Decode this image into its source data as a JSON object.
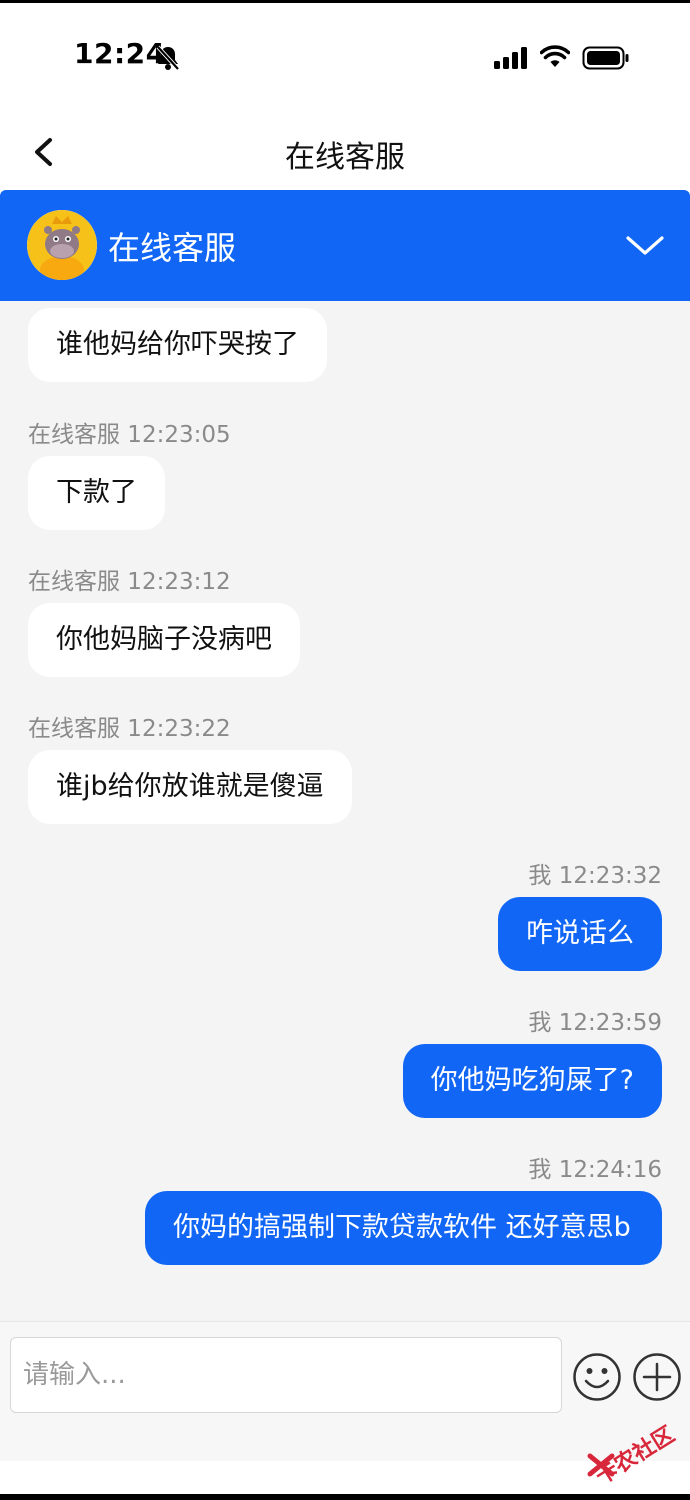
{
  "status_bar": {
    "time": "12:24"
  },
  "nav": {
    "title": "在线客服"
  },
  "agent_header": {
    "name": "在线客服"
  },
  "messages": [
    {
      "side": "in",
      "timestamp": "",
      "text": "谁他妈给你吓哭按了"
    },
    {
      "side": "in",
      "timestamp": "在线客服 12:23:05",
      "text": "下款了"
    },
    {
      "side": "in",
      "timestamp": "在线客服 12:23:12",
      "text": "你他妈脑子没病吧"
    },
    {
      "side": "in",
      "timestamp": "在线客服 12:23:22",
      "text": "谁jb给你放谁就是傻逼"
    },
    {
      "side": "out",
      "timestamp": "我 12:23:32",
      "text": "咋说话么"
    },
    {
      "side": "out",
      "timestamp": "我 12:23:59",
      "text": "你他妈吃狗屎了?"
    },
    {
      "side": "out",
      "timestamp": "我 12:24:16",
      "text": "你妈的搞强制下款贷款软件 还好意思b"
    }
  ],
  "input": {
    "placeholder": "请输入..."
  },
  "watermark": {
    "text": "卡农社区"
  },
  "colors": {
    "accent": "#1166f5",
    "chat_background": "#f4f4f4",
    "incoming_bubble": "#ffffff",
    "watermark": "#d8263a"
  },
  "icons": [
    "bell-off-icon",
    "signal-icon",
    "wifi-icon",
    "battery-icon",
    "back-chevron-icon",
    "chevron-down-icon",
    "emoji-icon",
    "plus-circle-icon"
  ]
}
